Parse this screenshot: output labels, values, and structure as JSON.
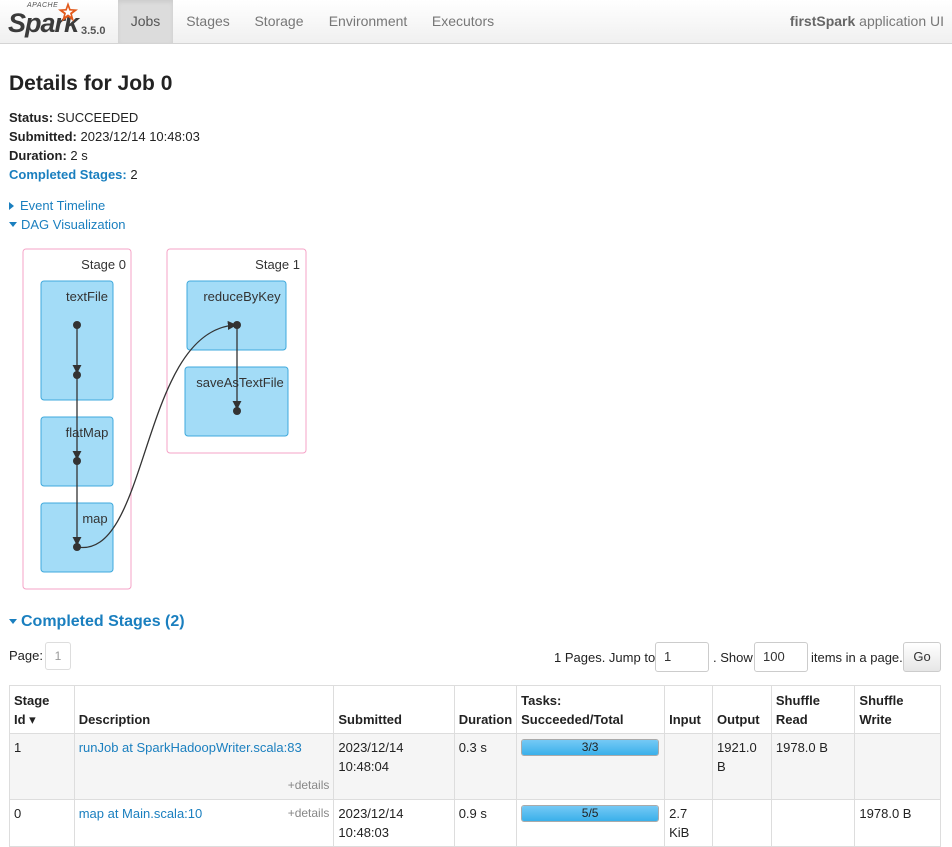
{
  "nav": {
    "brand_apache": "APACHE",
    "brand_name": "Spark",
    "version": "3.5.0",
    "tabs": [
      {
        "label": "Jobs",
        "active": true
      },
      {
        "label": "Stages",
        "active": false
      },
      {
        "label": "Storage",
        "active": false
      },
      {
        "label": "Environment",
        "active": false
      },
      {
        "label": "Executors",
        "active": false
      }
    ],
    "app_name": "firstSpark",
    "app_suffix": "application UI"
  },
  "job": {
    "title": "Details for Job 0",
    "status_label": "Status:",
    "status": "SUCCEEDED",
    "submitted_label": "Submitted:",
    "submitted": "2023/12/14 10:48:03",
    "duration_label": "Duration:",
    "duration": "2 s",
    "completed_stages_label": "Completed Stages:",
    "completed_stages": "2"
  },
  "toggles": {
    "event_timeline": "Event Timeline",
    "dag_visualization": "DAG Visualization"
  },
  "dag": {
    "stages": [
      {
        "label": "Stage 0",
        "nodes": [
          "textFile",
          "flatMap",
          "map"
        ]
      },
      {
        "label": "Stage 1",
        "nodes": [
          "reduceByKey",
          "saveAsTextFile"
        ]
      }
    ]
  },
  "completed_stages": {
    "title": "Completed Stages (2)",
    "page_label": "Page:",
    "current_page": "1",
    "pages_text": "1 Pages. Jump to",
    "jump_value": "1",
    "show_text": ". Show",
    "show_value": "100",
    "items_text": "items in a page.",
    "go_label": "Go",
    "columns": [
      "Stage Id ▾",
      "Description",
      "Submitted",
      "Duration",
      "Tasks: Succeeded/Total",
      "Input",
      "Output",
      "Shuffle Read",
      "Shuffle Write"
    ],
    "column_lines": {
      "stage_id": [
        "Stage",
        "Id ▾"
      ],
      "tasks": [
        "Tasks:",
        "Succeeded/Total"
      ],
      "shuffle_read": [
        "Shuffle",
        "Read"
      ],
      "shuffle_write": [
        "Shuffle",
        "Write"
      ]
    },
    "rows": [
      {
        "stage_id": "1",
        "description": "runJob at SparkHadoopWriter.scala:83",
        "details": "+details",
        "submitted": "2023/12/14 10:48:04",
        "duration": "0.3 s",
        "tasks": "3/3",
        "tasks_fraction": 1.0,
        "input": "",
        "output": "1921.0 B",
        "shuffle_read": "1978.0 B",
        "shuffle_write": ""
      },
      {
        "stage_id": "0",
        "description": "map at Main.scala:10",
        "details": "+details",
        "submitted": "2023/12/14 10:48:03",
        "duration": "0.9 s",
        "tasks": "5/5",
        "tasks_fraction": 1.0,
        "input": "2.7 KiB",
        "output": "",
        "shuffle_read": "",
        "shuffle_write": "1978.0 B"
      }
    ]
  },
  "colors": {
    "link": "#1a7fbf",
    "dag_node_fill": "#a3dcf7",
    "dag_node_stroke": "#3fa9dc",
    "dag_cluster_stroke": "#f5a3c7",
    "progress_fill": "#3ab0ea"
  }
}
